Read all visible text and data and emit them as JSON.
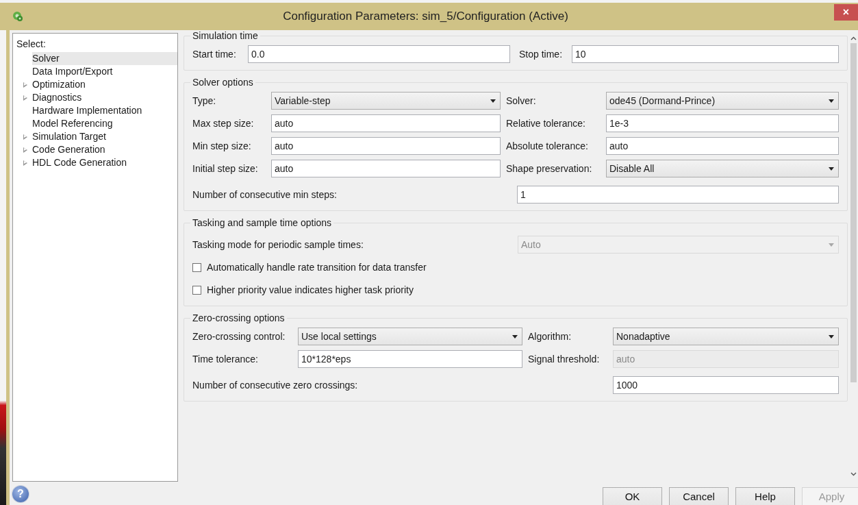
{
  "window": {
    "title": "Configuration Parameters: sim_5/Configuration (Active)",
    "close_button": "×"
  },
  "sidebar": {
    "heading": "Select:",
    "items": [
      {
        "label": "Solver",
        "selected": true,
        "expandable": false
      },
      {
        "label": "Data Import/Export",
        "selected": false,
        "expandable": false
      },
      {
        "label": "Optimization",
        "selected": false,
        "expandable": true
      },
      {
        "label": "Diagnostics",
        "selected": false,
        "expandable": true
      },
      {
        "label": "Hardware Implementation",
        "selected": false,
        "expandable": false
      },
      {
        "label": "Model Referencing",
        "selected": false,
        "expandable": false
      },
      {
        "label": "Simulation Target",
        "selected": false,
        "expandable": true
      },
      {
        "label": "Code Generation",
        "selected": false,
        "expandable": true
      },
      {
        "label": "HDL Code Generation",
        "selected": false,
        "expandable": true
      }
    ]
  },
  "groups": [
    {
      "title": "Simulation time",
      "rows": [
        {
          "kind": "pair",
          "cells": [
            {
              "label": "Start time:",
              "input": {
                "kind": "text",
                "value": "0.0",
                "disabled": false
              }
            },
            {
              "label": "Stop time:",
              "input": {
                "kind": "text",
                "value": "10",
                "disabled": false
              }
            }
          ]
        }
      ]
    },
    {
      "title": "Solver options",
      "rows": [
        {
          "kind": "pair",
          "cells": [
            {
              "label": "Type:",
              "input": {
                "kind": "select",
                "value": "Variable-step",
                "disabled": false
              }
            },
            {
              "label": "Solver:",
              "input": {
                "kind": "select",
                "value": "ode45 (Dormand-Prince)",
                "disabled": false
              }
            }
          ]
        },
        {
          "kind": "pair",
          "cells": [
            {
              "label": "Max step size:",
              "input": {
                "kind": "text",
                "value": "auto",
                "disabled": false
              }
            },
            {
              "label": "Relative tolerance:",
              "input": {
                "kind": "text",
                "value": "1e-3",
                "disabled": false
              }
            }
          ]
        },
        {
          "kind": "pair",
          "cells": [
            {
              "label": "Min step size:",
              "input": {
                "kind": "text",
                "value": "auto",
                "disabled": false
              }
            },
            {
              "label": "Absolute tolerance:",
              "input": {
                "kind": "text",
                "value": "auto",
                "disabled": false
              }
            }
          ]
        },
        {
          "kind": "pair",
          "cells": [
            {
              "label": "Initial step size:",
              "input": {
                "kind": "text",
                "value": "auto",
                "disabled": false
              }
            },
            {
              "label": "Shape preservation:",
              "input": {
                "kind": "select",
                "value": "Disable All",
                "disabled": false
              }
            }
          ]
        },
        {
          "kind": "wide",
          "label": "Number of consecutive min steps:",
          "input": {
            "kind": "text",
            "value": "1",
            "disabled": false
          }
        }
      ]
    },
    {
      "title": "Tasking and sample time options",
      "rows": [
        {
          "kind": "wide",
          "label": "Tasking mode for periodic sample times:",
          "input": {
            "kind": "select",
            "value": "Auto",
            "disabled": true
          }
        },
        {
          "kind": "checkbox",
          "label": "Automatically handle rate transition for data transfer",
          "checked": false
        },
        {
          "kind": "checkbox",
          "label": "Higher priority value indicates higher task priority",
          "checked": false
        }
      ]
    },
    {
      "title": "Zero-crossing options",
      "rows": [
        {
          "kind": "pair",
          "cells": [
            {
              "label": "Zero-crossing control:",
              "input": {
                "kind": "select",
                "value": "Use local settings",
                "disabled": false
              }
            },
            {
              "label": "Algorithm:",
              "input": {
                "kind": "select",
                "value": "Nonadaptive",
                "disabled": false
              }
            }
          ]
        },
        {
          "kind": "pair",
          "cells": [
            {
              "label": "Time tolerance:",
              "input": {
                "kind": "text",
                "value": "10*128*eps",
                "disabled": false
              }
            },
            {
              "label": "Signal threshold:",
              "input": {
                "kind": "text",
                "value": "auto",
                "disabled": true
              }
            }
          ]
        },
        {
          "kind": "wide",
          "label": "Number of consecutive zero crossings:",
          "input": {
            "kind": "text",
            "value": "1000",
            "disabled": false
          }
        }
      ]
    }
  ],
  "help_icon": "?",
  "buttons": [
    {
      "label": "OK",
      "disabled": false
    },
    {
      "label": "Cancel",
      "disabled": false
    },
    {
      "label": "Help",
      "disabled": false
    },
    {
      "label": "Apply",
      "disabled": true
    }
  ]
}
